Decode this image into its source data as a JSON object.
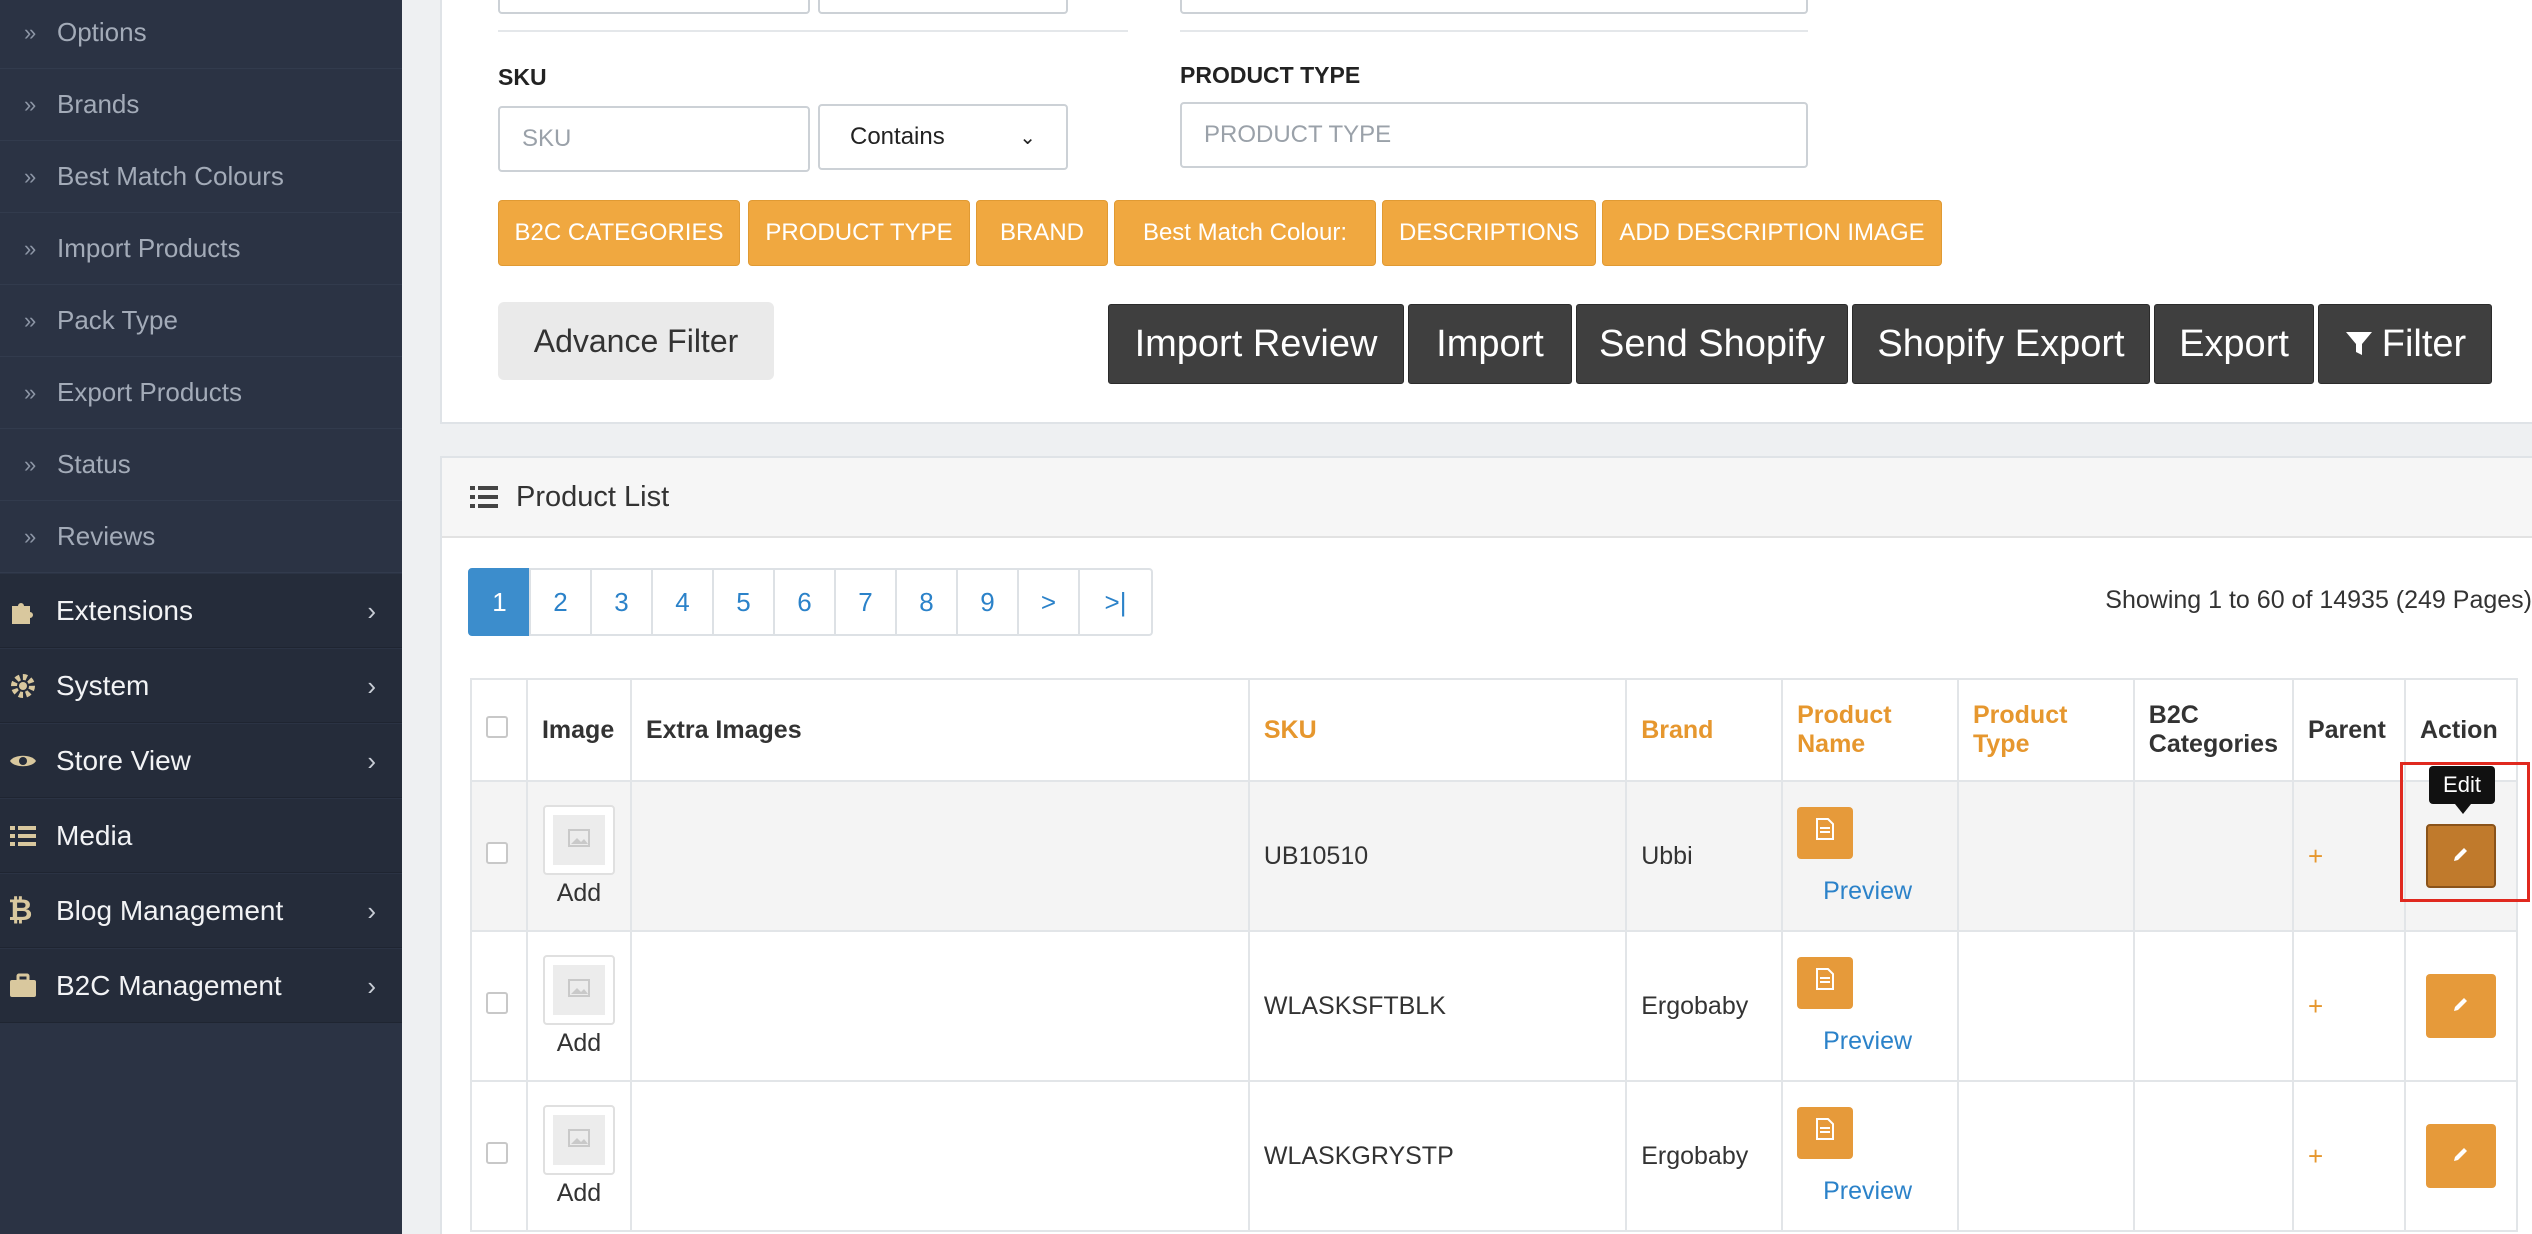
{
  "sidebar": {
    "sub_items": [
      "Options",
      "Brands",
      "Best Match Colours",
      "Import Products",
      "Pack Type",
      "Export Products",
      "Status",
      "Reviews"
    ],
    "main_items": [
      {
        "label": "Extensions",
        "icon": "puzzle-icon"
      },
      {
        "label": "System",
        "icon": "gear-icon"
      },
      {
        "label": "Store View",
        "icon": "eye-icon"
      },
      {
        "label": "Media",
        "icon": "list-icon"
      },
      {
        "label": "Blog Management",
        "icon": "bitcoin-icon"
      },
      {
        "label": "B2C Management",
        "icon": "briefcase-icon"
      }
    ]
  },
  "filters": {
    "sku_label": "SKU",
    "sku_placeholder": "SKU",
    "sku_operator": "Contains",
    "product_type_label": "PRODUCT TYPE",
    "product_type_placeholder": "PRODUCT TYPE",
    "tag_buttons": [
      "B2C CATEGORIES",
      "PRODUCT TYPE",
      "BRAND",
      "Best Match Colour:",
      "DESCRIPTIONS",
      "ADD DESCRIPTION IMAGE"
    ],
    "advance_filter": "Advance Filter",
    "action_buttons": [
      "Import Review",
      "Import",
      "Send Shopify",
      "Shopify Export",
      "Export",
      "Filter"
    ]
  },
  "product_list": {
    "title": "Product List",
    "pages": [
      "1",
      "2",
      "3",
      "4",
      "5",
      "6",
      "7",
      "8",
      "9",
      ">",
      ">|"
    ],
    "showing": "Showing 1 to 60 of 14935 (249 Pages)",
    "columns": {
      "image": "Image",
      "extra_images": "Extra Images",
      "sku": "SKU",
      "brand": "Brand",
      "product_name": "Product Name",
      "product_type": "Product Type",
      "b2c_categories": "B2C Categories",
      "parent": "Parent",
      "action": "Action"
    },
    "rows": [
      {
        "sku": "UB10510",
        "brand": "Ubbi",
        "add": "Add",
        "preview": "Preview",
        "parent": "+"
      },
      {
        "sku": "WLASKSFTBLK",
        "brand": "Ergobaby",
        "add": "Add",
        "preview": "Preview",
        "parent": "+"
      },
      {
        "sku": "WLASKGRYSTP",
        "brand": "Ergobaby",
        "add": "Add",
        "preview": "Preview",
        "parent": "+"
      }
    ],
    "tooltip": "Edit"
  },
  "colors": {
    "sidebar_bg": "#2b3344",
    "accent_orange": "#f0a840",
    "dark_button": "#3f3f3f",
    "link_blue": "#2b82c9",
    "highlight_red": "#e0291f"
  }
}
